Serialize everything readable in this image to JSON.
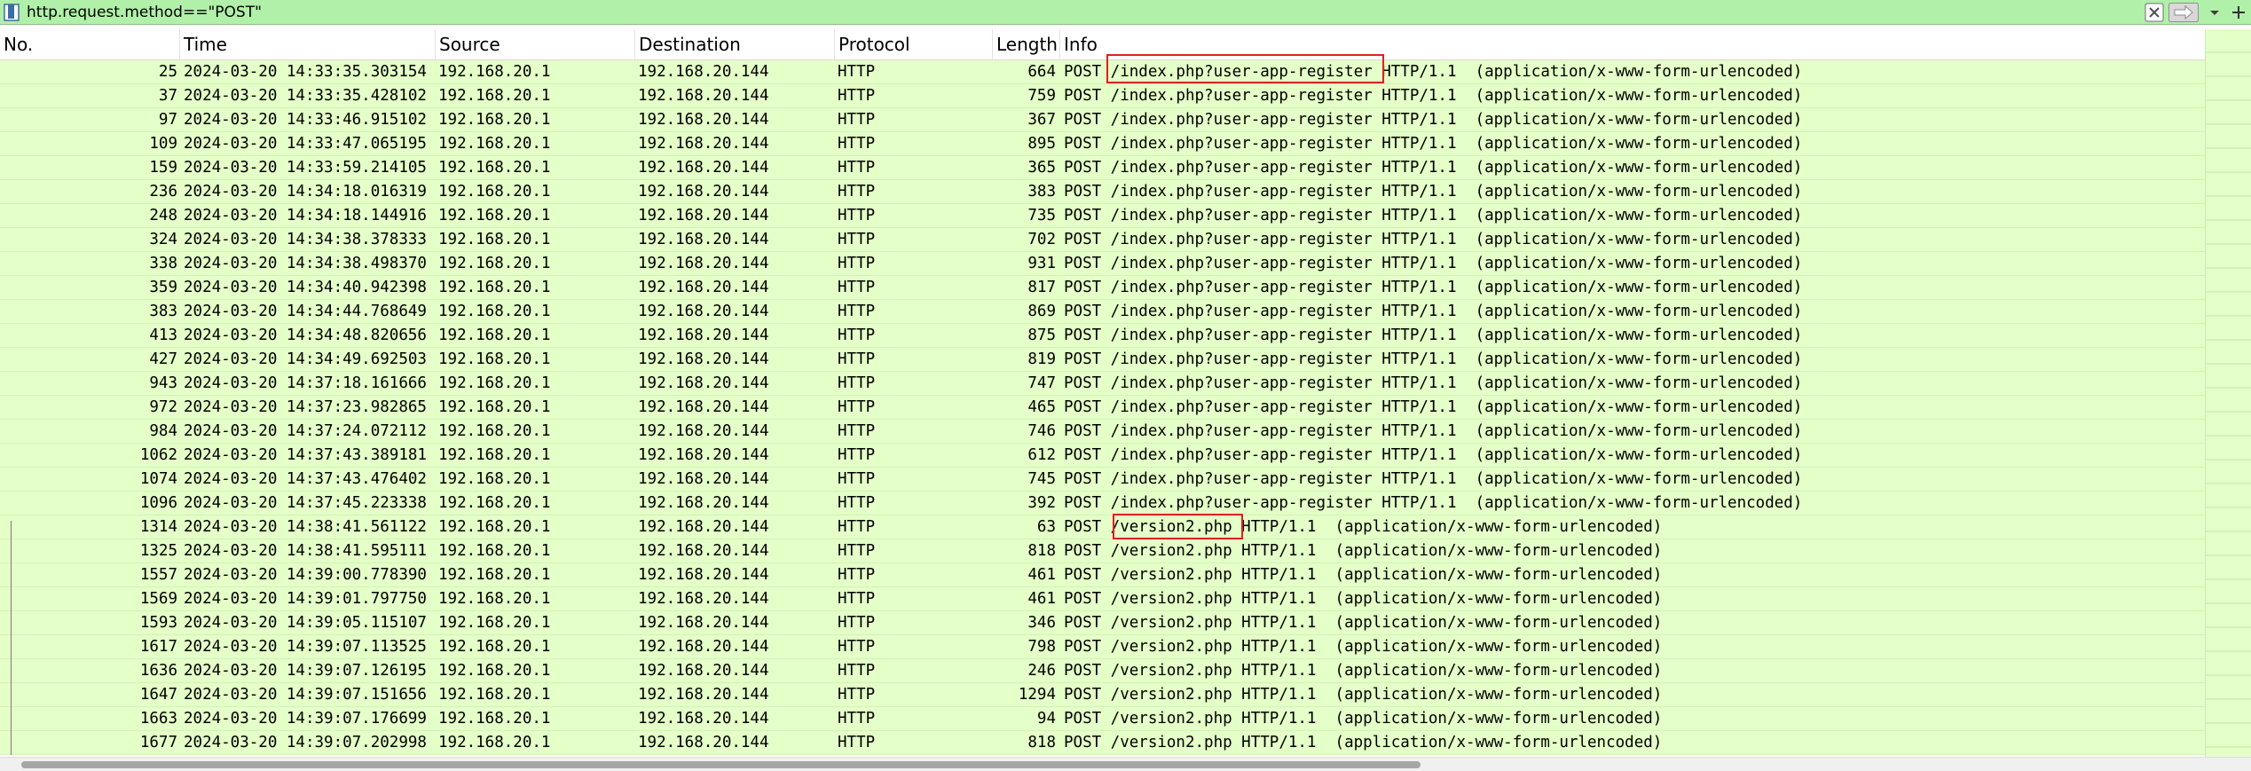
{
  "filter": {
    "text": "http.request.method==\"POST\""
  },
  "columns": [
    "No.",
    "Time",
    "Source",
    "Destination",
    "Protocol",
    "Length",
    "Info"
  ],
  "colors": {
    "row_bg": "#e4ffc7",
    "filter_bg": "#b0f0a8",
    "highlight": "#e0201e"
  },
  "rows": [
    {
      "no": "25",
      "time": "2024-03-20 14:33:35.303154",
      "src": "192.168.20.1",
      "dst": "192.168.20.144",
      "proto": "HTTP",
      "len": "664",
      "info": "POST /index.php?user-app-register HTTP/1.1  (application/x-www-form-urlencoded)"
    },
    {
      "no": "37",
      "time": "2024-03-20 14:33:35.428102",
      "src": "192.168.20.1",
      "dst": "192.168.20.144",
      "proto": "HTTP",
      "len": "759",
      "info": "POST /index.php?user-app-register HTTP/1.1  (application/x-www-form-urlencoded)"
    },
    {
      "no": "97",
      "time": "2024-03-20 14:33:46.915102",
      "src": "192.168.20.1",
      "dst": "192.168.20.144",
      "proto": "HTTP",
      "len": "367",
      "info": "POST /index.php?user-app-register HTTP/1.1  (application/x-www-form-urlencoded)"
    },
    {
      "no": "109",
      "time": "2024-03-20 14:33:47.065195",
      "src": "192.168.20.1",
      "dst": "192.168.20.144",
      "proto": "HTTP",
      "len": "895",
      "info": "POST /index.php?user-app-register HTTP/1.1  (application/x-www-form-urlencoded)"
    },
    {
      "no": "159",
      "time": "2024-03-20 14:33:59.214105",
      "src": "192.168.20.1",
      "dst": "192.168.20.144",
      "proto": "HTTP",
      "len": "365",
      "info": "POST /index.php?user-app-register HTTP/1.1  (application/x-www-form-urlencoded)"
    },
    {
      "no": "236",
      "time": "2024-03-20 14:34:18.016319",
      "src": "192.168.20.1",
      "dst": "192.168.20.144",
      "proto": "HTTP",
      "len": "383",
      "info": "POST /index.php?user-app-register HTTP/1.1  (application/x-www-form-urlencoded)"
    },
    {
      "no": "248",
      "time": "2024-03-20 14:34:18.144916",
      "src": "192.168.20.1",
      "dst": "192.168.20.144",
      "proto": "HTTP",
      "len": "735",
      "info": "POST /index.php?user-app-register HTTP/1.1  (application/x-www-form-urlencoded)"
    },
    {
      "no": "324",
      "time": "2024-03-20 14:34:38.378333",
      "src": "192.168.20.1",
      "dst": "192.168.20.144",
      "proto": "HTTP",
      "len": "702",
      "info": "POST /index.php?user-app-register HTTP/1.1  (application/x-www-form-urlencoded)"
    },
    {
      "no": "338",
      "time": "2024-03-20 14:34:38.498370",
      "src": "192.168.20.1",
      "dst": "192.168.20.144",
      "proto": "HTTP",
      "len": "931",
      "info": "POST /index.php?user-app-register HTTP/1.1  (application/x-www-form-urlencoded)"
    },
    {
      "no": "359",
      "time": "2024-03-20 14:34:40.942398",
      "src": "192.168.20.1",
      "dst": "192.168.20.144",
      "proto": "HTTP",
      "len": "817",
      "info": "POST /index.php?user-app-register HTTP/1.1  (application/x-www-form-urlencoded)"
    },
    {
      "no": "383",
      "time": "2024-03-20 14:34:44.768649",
      "src": "192.168.20.1",
      "dst": "192.168.20.144",
      "proto": "HTTP",
      "len": "869",
      "info": "POST /index.php?user-app-register HTTP/1.1  (application/x-www-form-urlencoded)"
    },
    {
      "no": "413",
      "time": "2024-03-20 14:34:48.820656",
      "src": "192.168.20.1",
      "dst": "192.168.20.144",
      "proto": "HTTP",
      "len": "875",
      "info": "POST /index.php?user-app-register HTTP/1.1  (application/x-www-form-urlencoded)"
    },
    {
      "no": "427",
      "time": "2024-03-20 14:34:49.692503",
      "src": "192.168.20.1",
      "dst": "192.168.20.144",
      "proto": "HTTP",
      "len": "819",
      "info": "POST /index.php?user-app-register HTTP/1.1  (application/x-www-form-urlencoded)"
    },
    {
      "no": "943",
      "time": "2024-03-20 14:37:18.161666",
      "src": "192.168.20.1",
      "dst": "192.168.20.144",
      "proto": "HTTP",
      "len": "747",
      "info": "POST /index.php?user-app-register HTTP/1.1  (application/x-www-form-urlencoded)"
    },
    {
      "no": "972",
      "time": "2024-03-20 14:37:23.982865",
      "src": "192.168.20.1",
      "dst": "192.168.20.144",
      "proto": "HTTP",
      "len": "465",
      "info": "POST /index.php?user-app-register HTTP/1.1  (application/x-www-form-urlencoded)"
    },
    {
      "no": "984",
      "time": "2024-03-20 14:37:24.072112",
      "src": "192.168.20.1",
      "dst": "192.168.20.144",
      "proto": "HTTP",
      "len": "746",
      "info": "POST /index.php?user-app-register HTTP/1.1  (application/x-www-form-urlencoded)"
    },
    {
      "no": "1062",
      "time": "2024-03-20 14:37:43.389181",
      "src": "192.168.20.1",
      "dst": "192.168.20.144",
      "proto": "HTTP",
      "len": "612",
      "info": "POST /index.php?user-app-register HTTP/1.1  (application/x-www-form-urlencoded)"
    },
    {
      "no": "1074",
      "time": "2024-03-20 14:37:43.476402",
      "src": "192.168.20.1",
      "dst": "192.168.20.144",
      "proto": "HTTP",
      "len": "745",
      "info": "POST /index.php?user-app-register HTTP/1.1  (application/x-www-form-urlencoded)"
    },
    {
      "no": "1096",
      "time": "2024-03-20 14:37:45.223338",
      "src": "192.168.20.1",
      "dst": "192.168.20.144",
      "proto": "HTTP",
      "len": "392",
      "info": "POST /index.php?user-app-register HTTP/1.1  (application/x-www-form-urlencoded)"
    },
    {
      "no": "1314",
      "time": "2024-03-20 14:38:41.561122",
      "src": "192.168.20.1",
      "dst": "192.168.20.144",
      "proto": "HTTP",
      "len": "63",
      "info": "POST /version2.php HTTP/1.1  (application/x-www-form-urlencoded)"
    },
    {
      "no": "1325",
      "time": "2024-03-20 14:38:41.595111",
      "src": "192.168.20.1",
      "dst": "192.168.20.144",
      "proto": "HTTP",
      "len": "818",
      "info": "POST /version2.php HTTP/1.1  (application/x-www-form-urlencoded)"
    },
    {
      "no": "1557",
      "time": "2024-03-20 14:39:00.778390",
      "src": "192.168.20.1",
      "dst": "192.168.20.144",
      "proto": "HTTP",
      "len": "461",
      "info": "POST /version2.php HTTP/1.1  (application/x-www-form-urlencoded)"
    },
    {
      "no": "1569",
      "time": "2024-03-20 14:39:01.797750",
      "src": "192.168.20.1",
      "dst": "192.168.20.144",
      "proto": "HTTP",
      "len": "461",
      "info": "POST /version2.php HTTP/1.1  (application/x-www-form-urlencoded)"
    },
    {
      "no": "1593",
      "time": "2024-03-20 14:39:05.115107",
      "src": "192.168.20.1",
      "dst": "192.168.20.144",
      "proto": "HTTP",
      "len": "346",
      "info": "POST /version2.php HTTP/1.1  (application/x-www-form-urlencoded)"
    },
    {
      "no": "1617",
      "time": "2024-03-20 14:39:07.113525",
      "src": "192.168.20.1",
      "dst": "192.168.20.144",
      "proto": "HTTP",
      "len": "798",
      "info": "POST /version2.php HTTP/1.1  (application/x-www-form-urlencoded)"
    },
    {
      "no": "1636",
      "time": "2024-03-20 14:39:07.126195",
      "src": "192.168.20.1",
      "dst": "192.168.20.144",
      "proto": "HTTP",
      "len": "246",
      "info": "POST /version2.php HTTP/1.1  (application/x-www-form-urlencoded)"
    },
    {
      "no": "1647",
      "time": "2024-03-20 14:39:07.151656",
      "src": "192.168.20.1",
      "dst": "192.168.20.144",
      "proto": "HTTP",
      "len": "1294",
      "info": "POST /version2.php HTTP/1.1  (application/x-www-form-urlencoded)"
    },
    {
      "no": "1663",
      "time": "2024-03-20 14:39:07.176699",
      "src": "192.168.20.1",
      "dst": "192.168.20.144",
      "proto": "HTTP",
      "len": "94",
      "info": "POST /version2.php HTTP/1.1  (application/x-www-form-urlencoded)"
    },
    {
      "no": "1677",
      "time": "2024-03-20 14:39:07.202998",
      "src": "192.168.20.1",
      "dst": "192.168.20.144",
      "proto": "HTTP",
      "len": "818",
      "info": "POST /version2.php HTTP/1.1  (application/x-www-form-urlencoded)"
    }
  ]
}
